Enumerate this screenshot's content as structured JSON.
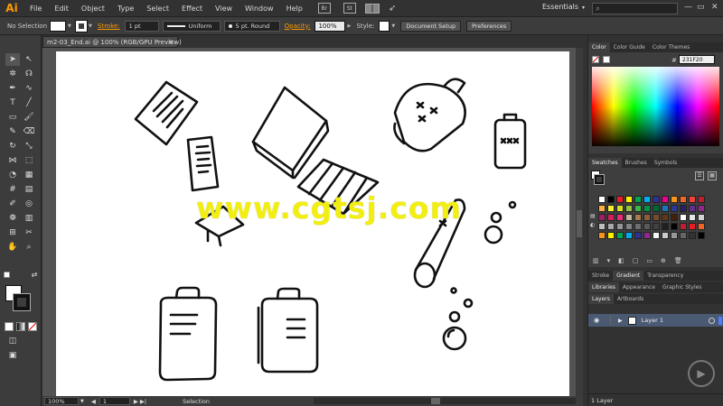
{
  "app": {
    "logo": "Ai"
  },
  "menu": [
    "File",
    "Edit",
    "Object",
    "Type",
    "Select",
    "Effect",
    "View",
    "Window",
    "Help"
  ],
  "bridge_labels": [
    "Br",
    "St"
  ],
  "workspace": {
    "label": "Essentials",
    "arrow": "▾"
  },
  "search_placeholder": "",
  "window_buttons": [
    "—",
    "▭",
    "✕"
  ],
  "control_bar": {
    "selection_label": "No Selection",
    "stroke_label": "Stroke:",
    "stroke_weight": "1 pt",
    "profile": "Uniform",
    "brush": "5 pt. Round",
    "opacity_label": "Opacity:",
    "opacity_value": "100%",
    "style_label": "Style:",
    "document_setup": "Document Setup",
    "preferences": "Preferences"
  },
  "document": {
    "tab_title": "m2-03_End.ai @ 100% (RGB/GPU Preview)",
    "close": "✕",
    "watermark": "www.cgtsj.com"
  },
  "status_bar": {
    "zoom": "100%",
    "artboard": "1",
    "mode": "Selection"
  },
  "color_panel": {
    "tabs": [
      "Color",
      "Color Guide",
      "Color Themes"
    ],
    "hex": "231F20"
  },
  "swatches_panel": {
    "tabs": [
      "Swatches",
      "Brushes",
      "Symbols"
    ],
    "colors": [
      [
        "#ffffff",
        "#000000",
        "#ed1c24",
        "#fff200",
        "#00a651",
        "#00aeef",
        "#2e3192",
        "#ec008c",
        "#f7941d",
        "#f26522",
        "#ef4136",
        "#be1e2d"
      ],
      [
        "#fbb040",
        "#f9ed32",
        "#d7df23",
        "#8dc63f",
        "#39b54a",
        "#009444",
        "#006838",
        "#1c75bc",
        "#2b3990",
        "#262262",
        "#662d91",
        "#92278f"
      ],
      [
        "#9e1f63",
        "#da1c5c",
        "#ee2a7b",
        "#c2b59b",
        "#a97c50",
        "#8b5e3c",
        "#754c29",
        "#603913",
        "#42210b",
        "#ffffff",
        "#e6e7e8",
        "#d1d3d4"
      ],
      [
        "#bcbec0",
        "#a7a9ac",
        "#939598",
        "#808285",
        "#6d6e71",
        "#58595b",
        "#414042",
        "#231f20",
        "#000000",
        "#be1e2d",
        "#ed1c24",
        "#f26522"
      ],
      [
        "#f7941d",
        "#fff200",
        "#00a651",
        "#00aeef",
        "#2e3192",
        "#92278f",
        "#f5f5f5",
        "#cccccc",
        "#999999",
        "#666666",
        "#333333",
        "#000000"
      ]
    ]
  },
  "stroke_panel": {
    "tabs": [
      "Stroke",
      "Gradient",
      "Transparency"
    ]
  },
  "libraries_panel": {
    "tabs": [
      "Libraries",
      "Appearance",
      "Graphic Styles"
    ]
  },
  "layers_panel": {
    "tabs": [
      "Layers",
      "Artboards"
    ],
    "layers": [
      {
        "name": "Layer 1"
      }
    ],
    "footer": "1 Layer"
  }
}
